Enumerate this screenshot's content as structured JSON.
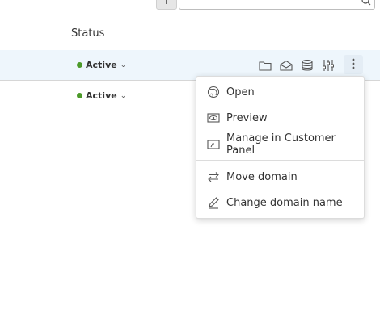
{
  "table": {
    "status_header": "Status",
    "rows": [
      {
        "status": "Active",
        "highlighted": true
      },
      {
        "status": "Active",
        "highlighted": false
      }
    ]
  },
  "row_actions": [
    "folder-icon",
    "mail-icon",
    "database-icon",
    "settings-sliders-icon",
    "more-vertical-icon"
  ],
  "context_menu": {
    "items": [
      {
        "label": "Open",
        "icon": "globe-icon"
      },
      {
        "label": "Preview",
        "icon": "eye-icon"
      },
      {
        "label": "Manage in Customer Panel",
        "icon": "panel-icon"
      },
      {
        "label": "Move domain",
        "icon": "arrows-swap-icon"
      },
      {
        "label": "Change domain name",
        "icon": "pencil-icon"
      }
    ]
  },
  "colors": {
    "active_dot": "#4c9a2a",
    "row_highlight": "#eef6fc"
  }
}
